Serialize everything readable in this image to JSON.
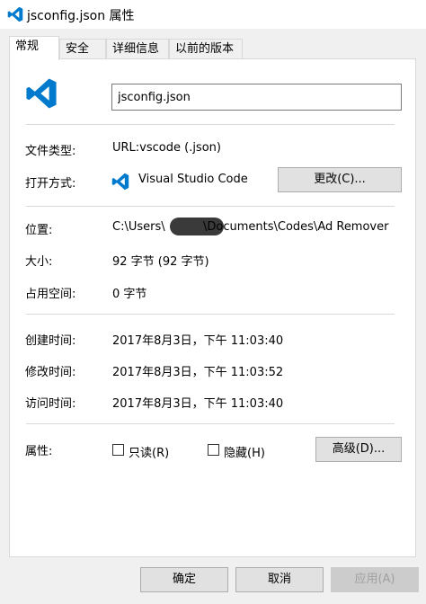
{
  "window": {
    "title": "jsconfig.json 属性"
  },
  "tabs": [
    {
      "label": "常规",
      "active": true
    },
    {
      "label": "安全",
      "active": false
    },
    {
      "label": "详细信息",
      "active": false
    },
    {
      "label": "以前的版本",
      "active": false
    }
  ],
  "general": {
    "file_name": "jsconfig.json",
    "file_type_label": "文件类型:",
    "file_type_value": "URL:vscode (.json)",
    "open_with_label": "打开方式:",
    "open_with_value": "Visual Studio Code",
    "change_button": "更改(C)...",
    "location_label": "位置:",
    "location_prefix": "C:\\Users\\",
    "location_suffix": "\\Documents\\Codes\\Ad Remover",
    "size_label": "大小:",
    "size_value": "92 字节 (92 字节)",
    "disk_size_label": "占用空间:",
    "disk_size_value": "0 字节",
    "created_label": "创建时间:",
    "created_value": "2017年8月3日，下午 11:03:40",
    "modified_label": "修改时间:",
    "modified_value": "2017年8月3日，下午 11:03:52",
    "accessed_label": "访问时间:",
    "accessed_value": "2017年8月3日，下午 11:03:40",
    "attributes_label": "属性:",
    "readonly_label": "只读(R)",
    "readonly_checked": false,
    "hidden_label": "隐藏(H)",
    "hidden_checked": false,
    "advanced_button": "高级(D)..."
  },
  "footer": {
    "ok_button": "确定",
    "cancel_button": "取消",
    "apply_button": "应用(A)"
  },
  "colors": {
    "vscode_blue": "#0065a9",
    "vscode_blue_light": "#007acc"
  }
}
